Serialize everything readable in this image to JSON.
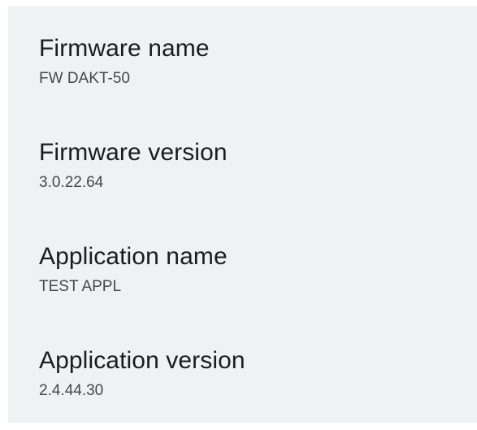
{
  "info": {
    "items": [
      {
        "title": "Firmware name",
        "value": "FW DAKT-50"
      },
      {
        "title": "Firmware version",
        "value": "3.0.22.64"
      },
      {
        "title": "Application name",
        "value": "TEST APPL"
      },
      {
        "title": "Application version",
        "value": "2.4.44.30"
      }
    ]
  },
  "colors": {
    "panel_background": "#f0f1f4",
    "title_text": "#1c1c1e",
    "value_text": "#45474b"
  }
}
